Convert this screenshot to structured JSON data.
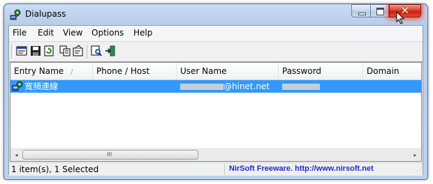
{
  "window": {
    "title": "Dialupass"
  },
  "menu": [
    "File",
    "Edit",
    "View",
    "Options",
    "Help"
  ],
  "toolbar": {
    "buttons": [
      "properties-icon",
      "save-icon",
      "refresh-icon",
      "copy-icon",
      "options-icon",
      "find-icon",
      "exit-icon"
    ]
  },
  "columns": [
    "Entry Name",
    "Phone / Host",
    "User Name",
    "Password",
    "Domain"
  ],
  "sort_indicator": "/",
  "rows": [
    {
      "entry_name": "寬頻連線",
      "phone_host": "",
      "user_name_visible": "@hinet.net",
      "password_visible": "",
      "domain": "",
      "selected": true
    }
  ],
  "scrollbar": {
    "left_arrow": "◂",
    "right_arrow": "▸",
    "grip": "III"
  },
  "status": {
    "items": "1 item(s), 1 Selected",
    "link": "NirSoft Freeware.  http://www.nirsoft.net"
  },
  "colors": {
    "selection": "#3399ff",
    "link": "#1c2bd0",
    "close_button": "#e0412a"
  }
}
